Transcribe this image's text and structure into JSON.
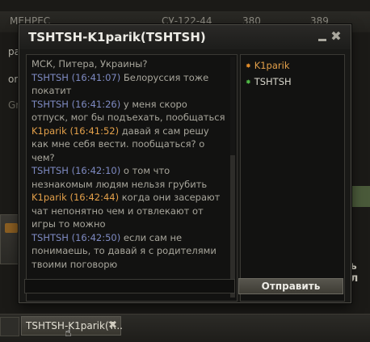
{
  "background": {
    "top_row": [
      "МЕНРЕС",
      "СУ-122-44",
      "380",
      "389"
    ],
    "left_rows": [
      "ра",
      "on",
      "Gra"
    ],
    "right_text": "ть сл"
  },
  "dialog": {
    "title": "TSHTSH-K1parik(TSHTSH)",
    "messages": [
      {
        "sender": "",
        "time": "",
        "text": "МСК, Питера, Украины?",
        "color": "plain"
      },
      {
        "sender": "TSHTSH",
        "time": "(16:41:07)",
        "text": "Белоруссия тоже покатит",
        "color": "blue"
      },
      {
        "sender": "TSHTSH",
        "time": "(16:41:26)",
        "text": "у меня скоро отпуск, мог бы подъехать, пообщаться",
        "color": "blue"
      },
      {
        "sender": "K1parik",
        "time": "(16:41:52)",
        "text": "давай я сам решу как мне себя вести. пообщаться? о чем?",
        "color": "orange"
      },
      {
        "sender": "TSHTSH",
        "time": "(16:42:10)",
        "text": "о том что незнакомым людям нельзя грубить",
        "color": "blue"
      },
      {
        "sender": "K1parik",
        "time": "(16:42:44)",
        "text": "когда они засерают чат непонятно чем и отвлекают от игры то можно",
        "color": "orange"
      },
      {
        "sender": "TSHTSH",
        "time": "(16:42:50)",
        "text": "если сам не понимаешь, то давай я с родителями твоими поговорю",
        "color": "blue"
      }
    ],
    "users": [
      {
        "name": "K1parik",
        "status_color": "#e38d2a"
      },
      {
        "name": "TSHTSH",
        "status_color": "#4fb845"
      }
    ],
    "input": {
      "value": "",
      "placeholder": ""
    },
    "send_label": "Отправить"
  },
  "taskbar": {
    "tab_label": "TSHTSH-K1parik(T..."
  }
}
